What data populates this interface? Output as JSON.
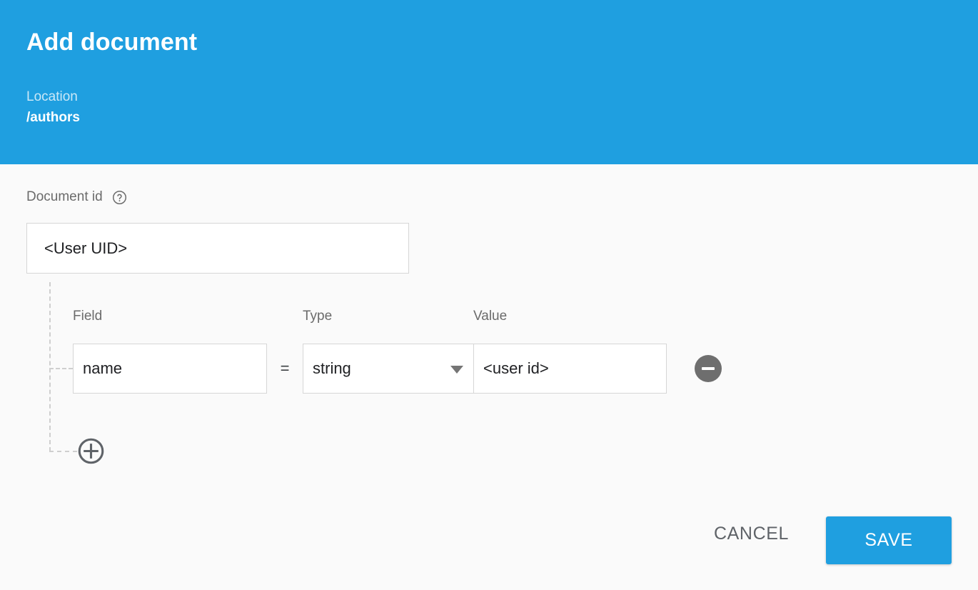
{
  "header": {
    "title": "Add document",
    "location_label": "Location",
    "location_path": "/authors",
    "background_color": "#1f9fe0"
  },
  "form": {
    "document_id": {
      "label": "Document id",
      "help_icon": "help-circle-icon",
      "value": "<User UID>",
      "placeholder": "<User UID>"
    },
    "columns": {
      "field": "Field",
      "type": "Type",
      "value": "Value"
    },
    "rows": [
      {
        "field": "name",
        "equals": "=",
        "type": "string",
        "type_caret_icon": "chevron-down-icon",
        "value": "<user id>",
        "remove_icon": "minus-circle-icon"
      }
    ],
    "add_icon": "plus-circle-icon"
  },
  "footer": {
    "cancel_label": "CANCEL",
    "save_label": "SAVE",
    "save_color": "#1f9fe0"
  }
}
